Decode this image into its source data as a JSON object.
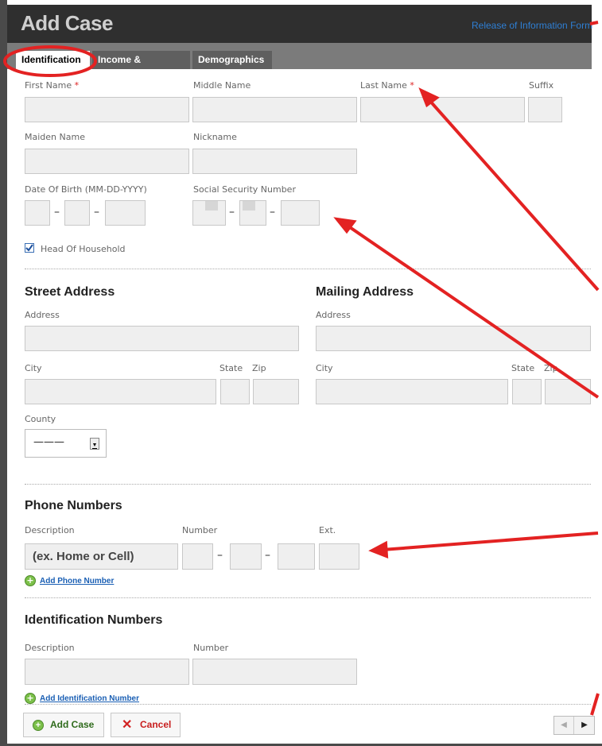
{
  "header": {
    "title": "Add Case",
    "release_link": "Release of Information Form"
  },
  "tabs": [
    {
      "label": "Identification"
    },
    {
      "label": "Income & Expenses"
    },
    {
      "label": "Demographics"
    }
  ],
  "identification": {
    "first_name": "First Name",
    "middle_name": "Middle Name",
    "last_name": "Last Name",
    "suffix": "Suffix",
    "required_mark": "*",
    "maiden_name": "Maiden Name",
    "nickname": "Nickname",
    "dob": "Date Of Birth (MM-DD-YYYY)",
    "ssn": "Social Security Number",
    "head_of_household": "Head Of Household",
    "head_of_household_checked": true
  },
  "street_address": {
    "title": "Street Address",
    "address": "Address",
    "city": "City",
    "state": "State",
    "zip": "Zip",
    "county": "County",
    "county_value": "———"
  },
  "mailing_address": {
    "title": "Mailing Address",
    "address": "Address",
    "city": "City",
    "state": "State",
    "zip": "Zip"
  },
  "phone": {
    "title": "Phone Numbers",
    "description": "Description",
    "number": "Number",
    "ext": "Ext.",
    "description_placeholder": "(ex. Home or Cell)",
    "add_link": "Add Phone Number"
  },
  "ids": {
    "title": "Identification Numbers",
    "description": "Description",
    "number": "Number",
    "add_link": "Add Identification Number"
  },
  "footer": {
    "add_case": "Add Case",
    "cancel": "Cancel"
  },
  "colors": {
    "header_bg": "#2f2f2f",
    "link": "#2f7fd4",
    "annotation": "#e32222",
    "add_green": "#7cc04a",
    "cancel_red": "#d22222"
  }
}
